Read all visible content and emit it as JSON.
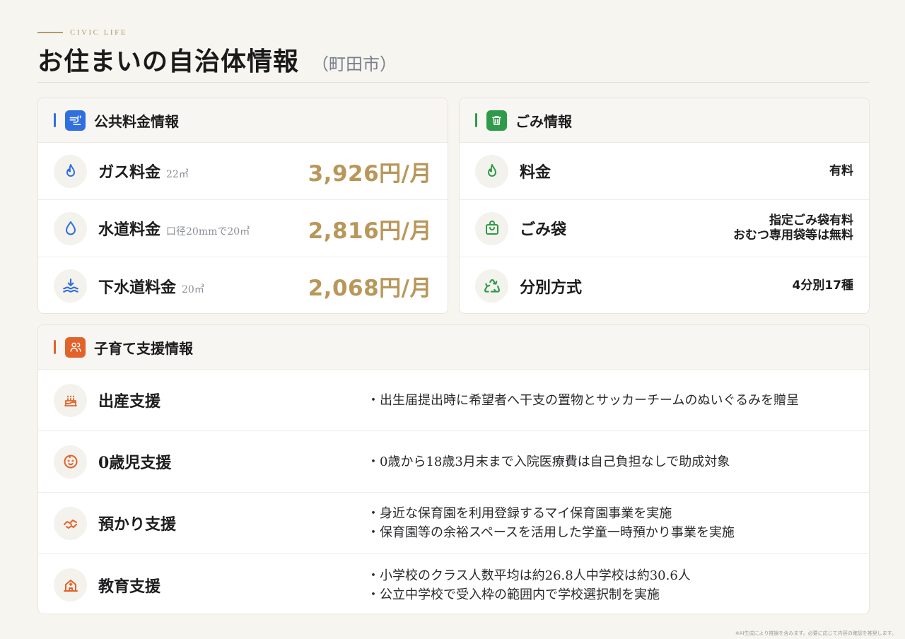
{
  "header": {
    "eyebrow": "CIVIC LIFE",
    "title": "お住まいの自治体情報",
    "subtitle": "（町田市）"
  },
  "colors": {
    "blue": "#2f6fe0",
    "green": "#2e9a4a",
    "orange": "#e2622a",
    "gold": "#b8975a"
  },
  "utilities": {
    "title": "公共料金情報",
    "icon": "pipes-icon",
    "items": [
      {
        "icon": "flame-icon",
        "label": "ガス料金",
        "note": "22㎥",
        "price": "3,926円/月"
      },
      {
        "icon": "water-drop-icon",
        "label": "水道料金",
        "note": "口径20mmで20㎥",
        "price": "2,816円/月"
      },
      {
        "icon": "waves-icon",
        "label": "下水道料金",
        "note": "20㎥",
        "price": "2,068円/月"
      }
    ]
  },
  "garbage": {
    "title": "ごみ情報",
    "icon": "trash-icon",
    "items": [
      {
        "icon": "flame-icon",
        "label": "料金",
        "value_line1": "有料",
        "value_line2": ""
      },
      {
        "icon": "bag-icon",
        "label": "ごみ袋",
        "value_line1": "指定ごみ袋有料",
        "value_line2": "おむつ専用袋等は無料"
      },
      {
        "icon": "recycle-icon",
        "label": "分別方式",
        "value_line1": "4分別17種",
        "value_line2": ""
      }
    ]
  },
  "childcare": {
    "title": "子育て支援情報",
    "icon": "people-icon",
    "items": [
      {
        "icon": "cake-icon",
        "label": "出産支援",
        "line1": "・出生届提出時に希望者へ干支の置物とサッカーチームのぬいぐるみを贈呈",
        "line2": ""
      },
      {
        "icon": "baby-icon",
        "label": "0歳児支援",
        "line1": "・0歳から18歳3月末まで入院医療費は自己負担なしで助成対象",
        "line2": ""
      },
      {
        "icon": "handshake-icon",
        "label": "預かり支援",
        "line1": "・身近な保育園を利用登録するマイ保育園事業を実施",
        "line2": "・保育園等の余裕スペースを活用した学童一時預かり事業を実施"
      },
      {
        "icon": "school-icon",
        "label": "教育支援",
        "line1": "・小学校のクラス人数平均は約26.8人中学校は約30.6人",
        "line2": "・公立中学校で受入枠の範囲内で学校選択制を実施"
      }
    ]
  },
  "footnote": "※AI生成により推論を含みます。必要に応じて内容の確認を推奨します。"
}
